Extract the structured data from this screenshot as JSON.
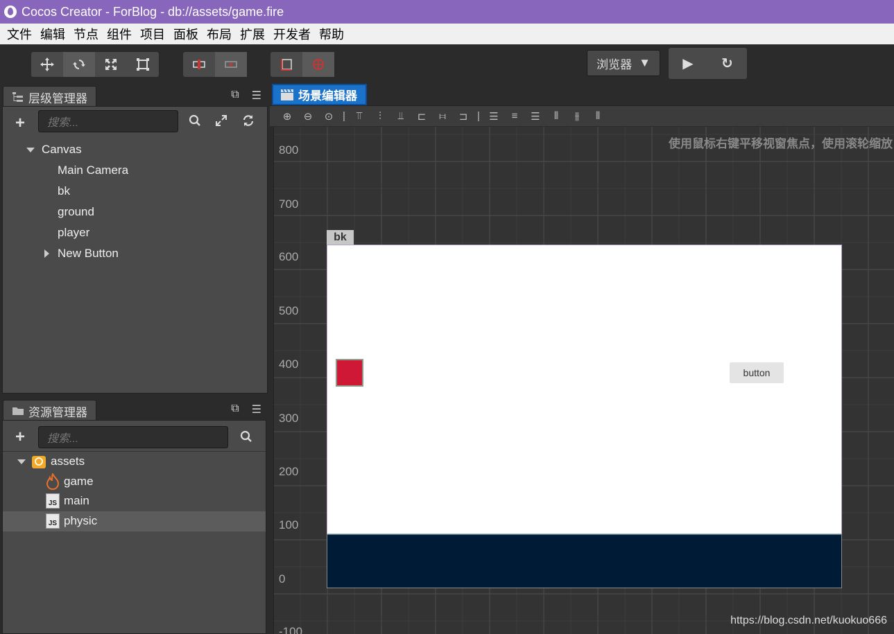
{
  "window": {
    "title": "Cocos Creator - ForBlog - db://assets/game.fire"
  },
  "menu": [
    "文件",
    "编辑",
    "节点",
    "组件",
    "项目",
    "面板",
    "布局",
    "扩展",
    "开发者",
    "帮助"
  ],
  "toolbar": {
    "transform_tools": [
      "move-icon",
      "rotate-icon",
      "scale-icon",
      "rect-icon"
    ],
    "pivot_tools": [
      "pivot-icon",
      "local-icon"
    ],
    "coord_tools": [
      "coord-icon",
      "global-icon"
    ],
    "preview_target": "浏览器",
    "play_icon": "play-icon",
    "refresh_icon": "refresh-icon"
  },
  "hierarchy": {
    "title": "层级管理器",
    "search_placeholder": "搜索...",
    "nodes": [
      {
        "label": "Canvas",
        "level": 0,
        "expand": "open"
      },
      {
        "label": "Main Camera",
        "level": 1
      },
      {
        "label": "bk",
        "level": 1
      },
      {
        "label": "ground",
        "level": 1
      },
      {
        "label": "player",
        "level": 1
      },
      {
        "label": "New Button",
        "level": 1,
        "expand": "closed"
      }
    ]
  },
  "assets": {
    "title": "资源管理器",
    "search_placeholder": "搜索...",
    "items": [
      {
        "label": "assets",
        "type": "folder"
      },
      {
        "label": "game",
        "type": "fire"
      },
      {
        "label": "main",
        "type": "js"
      },
      {
        "label": "physic",
        "type": "js",
        "selected": true
      }
    ]
  },
  "scene": {
    "tab_title": "场景编辑器",
    "hint": "使用鼠标右键平移视窗焦点，使用滚轮缩放",
    "y_ticks": [
      "800",
      "700",
      "600",
      "500",
      "400",
      "300",
      "200",
      "100",
      "0",
      "-100"
    ],
    "canvas_label": "bk",
    "button_text": "button",
    "colors": {
      "background": "#ffffff",
      "ground": "#001b35",
      "player": "#cf1836"
    }
  },
  "watermark": "https://blog.csdn.net/kuokuo666"
}
